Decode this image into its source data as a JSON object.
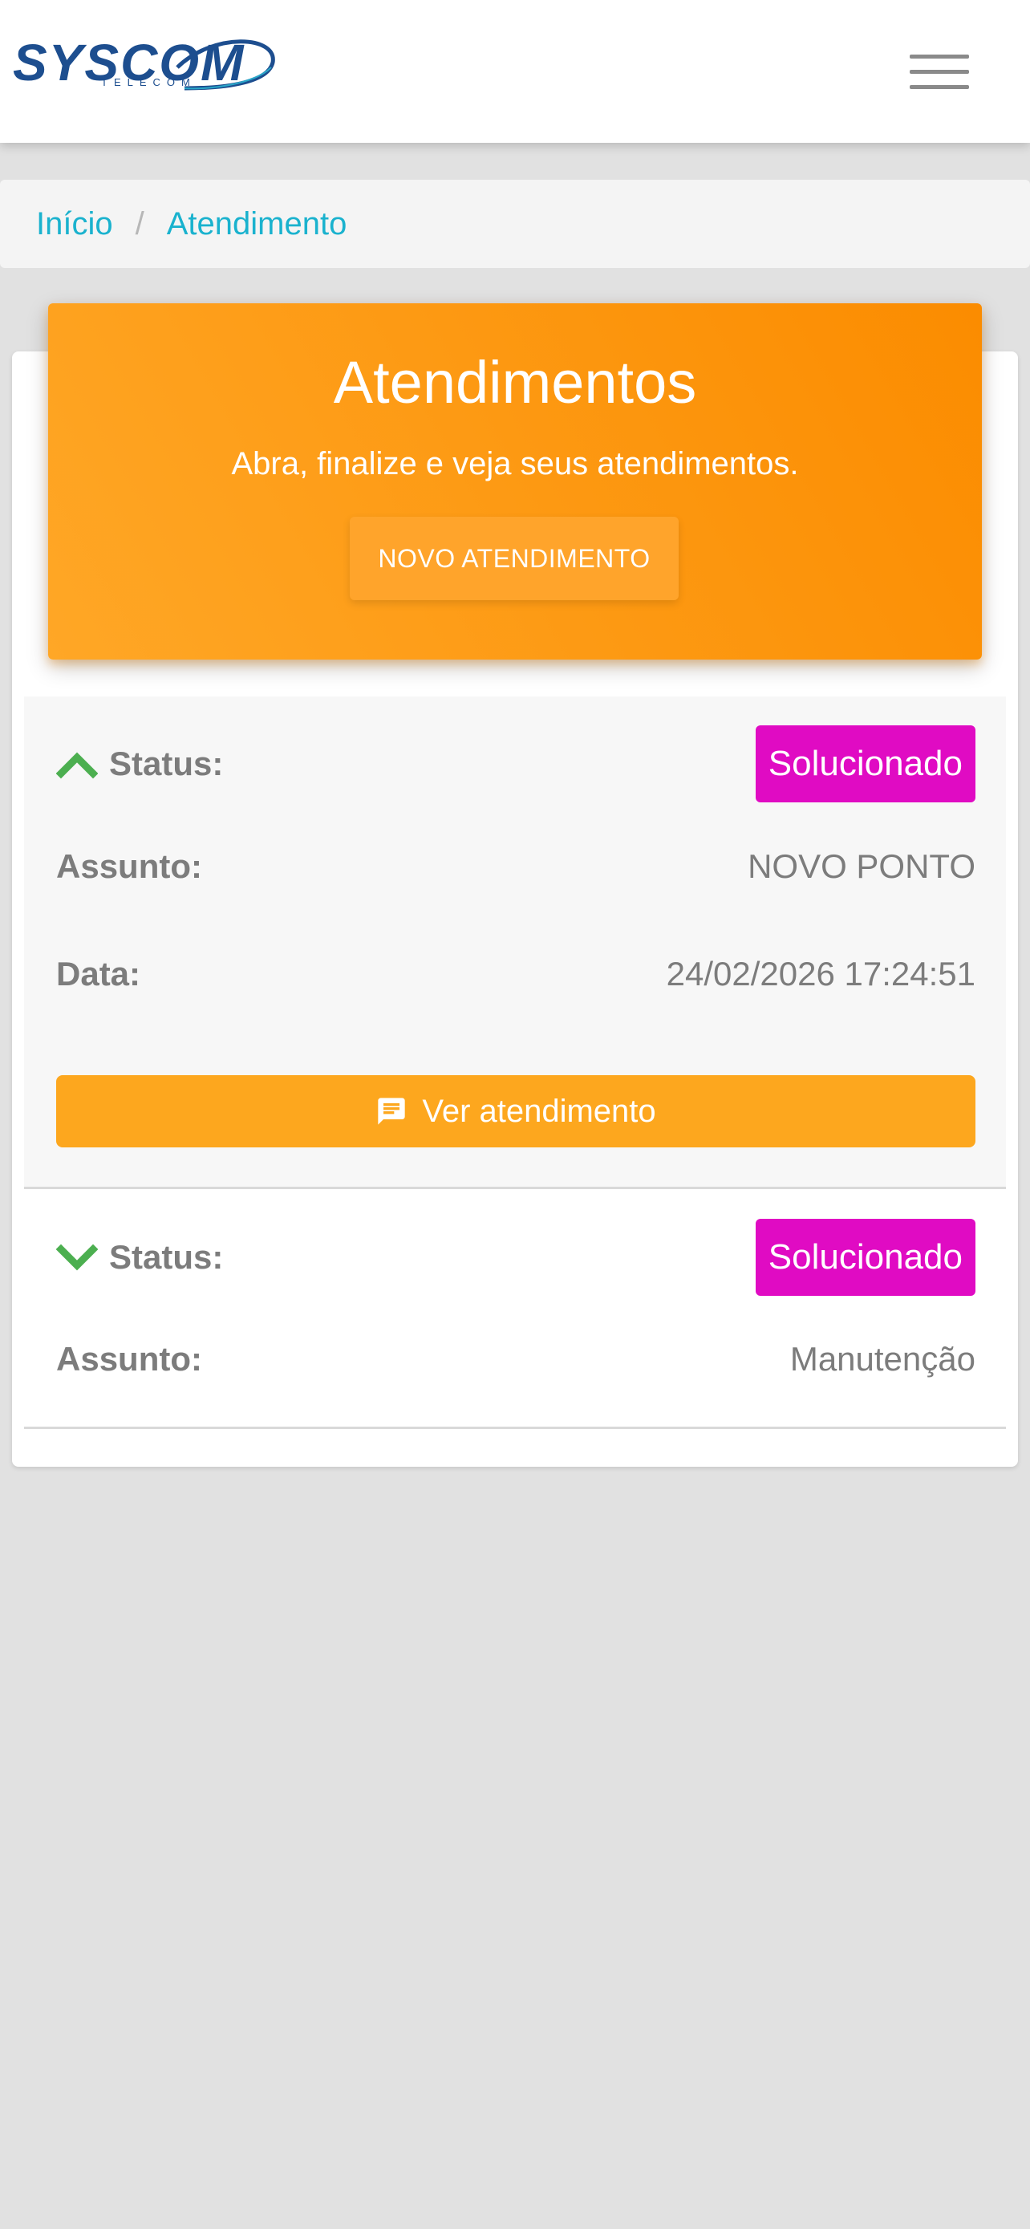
{
  "header": {
    "logo_text": "SYSCOM",
    "logo_subtext": "TELECOM",
    "menu_icon": "hamburger-icon"
  },
  "breadcrumb": {
    "items": [
      {
        "label": "Início"
      },
      {
        "label": "Atendimento"
      }
    ],
    "separator": "/"
  },
  "hero": {
    "title": "Atendimentos",
    "subtitle": "Abra, finalize e veja seus atendimentos.",
    "button_label": "NOVO ATENDIMENTO"
  },
  "tickets": [
    {
      "expanded": true,
      "toggle_icon": "chevron-up-icon",
      "status_label": "Status:",
      "status": "Solucionado",
      "subject_label": "Assunto:",
      "subject": "NOVO PONTO",
      "date_label": "Data:",
      "date": "24/02/2026 17:24:51",
      "action_icon": "message-icon",
      "action_label": "Ver atendimento"
    },
    {
      "expanded": false,
      "toggle_icon": "chevron-down-icon",
      "status_label": "Status:",
      "status": "Solucionado",
      "subject_label": "Assunto:",
      "subject": "Manutenção"
    }
  ],
  "colors": {
    "accent_orange": "#fb8c00",
    "status_badge": "#e00bc3",
    "link": "#1ab2ce",
    "chevron": "#4caf50",
    "logo_blue": "#1d4e8f"
  }
}
